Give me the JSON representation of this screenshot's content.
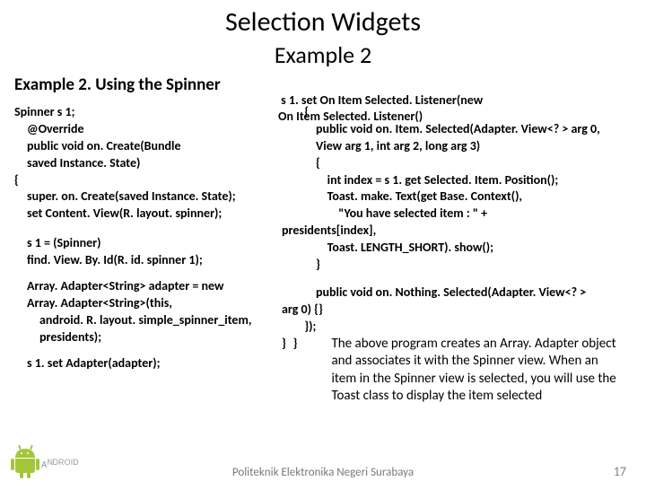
{
  "title": "Selection Widgets",
  "subtitle": "Example 2",
  "section_heading": "Example 2. Using the Spinner",
  "listener_top": " s 1. set On Item Selected. Listener(new\nOn Item Selected. Listener()",
  "left": {
    "l1": "Spinner s 1;",
    "l2": "@Override",
    "l3": "public void on. Create(Bundle",
    "l4": "saved Instance. State)",
    "l5": "{",
    "l6": "super. on. Create(saved Instance. State);",
    "l7": "set Content. View(R. layout. spinner);",
    "l8": "s 1 = (Spinner)",
    "l9": "find. View. By. Id(R. id. spinner 1);",
    "l10": "Array. Adapter<String> adapter = new",
    "l11": "Array. Adapter<String>(this,",
    "l12": "android. R. layout. simple_spinner_item,",
    "l13": "presidents);",
    "l14": "s 1. set Adapter(adapter);"
  },
  "right": {
    "r1": "        {",
    "r2": "            public void on. Item. Selected(Adapter. View<? > arg 0,",
    "r3": "            View arg 1, int arg 2, long arg 3)",
    "r4": "            {",
    "r5": "                int index = s 1. get Selected. Item. Position();",
    "r6": "                Toast. make. Text(get Base. Context(),",
    "r7": "                    \"You have selected item : \" +",
    "r8": "presidents[index],",
    "r9": "                Toast. LENGTH_SHORT). show();",
    "r10": "            }",
    "r11": "            public void on. Nothing. Selected(Adapter. View<? >",
    "r12": "arg 0) {}",
    "r13": "        });",
    "r14": "    }",
    "r15": "}"
  },
  "explain": "The above program creates an Array. Adapter object and associates it with the Spinner view. When an item in the Spinner view is selected, you will use the Toast class to display the item selected",
  "footer": "Politeknik Elektronika Negeri Surabaya",
  "wordmark": "ᴀᴺᴰᴿᴼᴵᴰ",
  "page": "17"
}
